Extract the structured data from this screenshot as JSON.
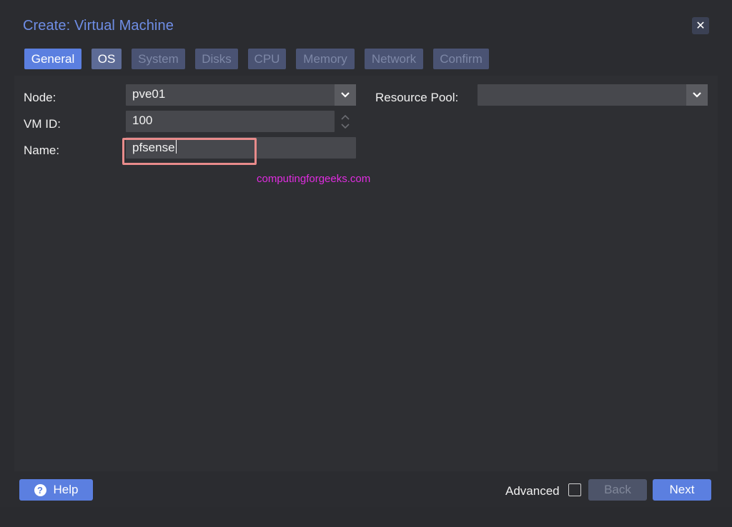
{
  "window": {
    "title": "Create: Virtual Machine",
    "close_glyph": "✕"
  },
  "tabs": [
    {
      "label": "General",
      "state": "active"
    },
    {
      "label": "OS",
      "state": "normal"
    },
    {
      "label": "System",
      "state": "disabled"
    },
    {
      "label": "Disks",
      "state": "disabled"
    },
    {
      "label": "CPU",
      "state": "disabled"
    },
    {
      "label": "Memory",
      "state": "disabled"
    },
    {
      "label": "Network",
      "state": "disabled"
    },
    {
      "label": "Confirm",
      "state": "disabled"
    }
  ],
  "form": {
    "node": {
      "label": "Node:",
      "value": "pve01"
    },
    "vm_id": {
      "label": "VM ID:",
      "value": "100"
    },
    "name": {
      "label": "Name:",
      "value": "pfsense"
    },
    "resource_pool": {
      "label": "Resource Pool:",
      "value": ""
    }
  },
  "watermark": "computingforgeeks.com",
  "footer": {
    "help_label": "Help",
    "help_icon_glyph": "?",
    "advanced_label": "Advanced",
    "advanced_checked": false,
    "back_label": "Back",
    "next_label": "Next"
  },
  "colors": {
    "accent": "#5b7fe0",
    "title": "#6f8ee6",
    "highlight": "#e88b8b",
    "watermark": "#e02ce0"
  }
}
